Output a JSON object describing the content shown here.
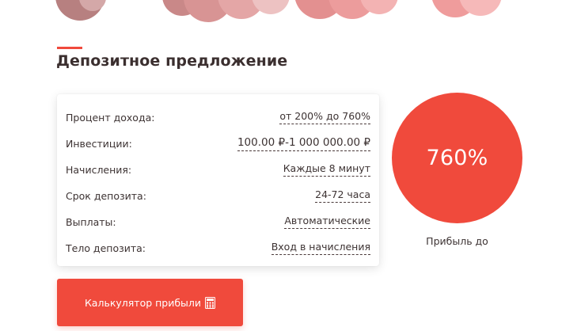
{
  "theme": {
    "accent": "#f04a3c",
    "text": "#3d3333"
  },
  "page": {
    "title": "Депозитное предложение"
  },
  "offer": {
    "rows": [
      {
        "label": "Процент дохода:",
        "value": "от 200% до 760%"
      },
      {
        "label": "Инвестиции:",
        "value": "100.00 ₽-1 000 000.00 ₽"
      },
      {
        "label": "Начисления:",
        "value": "Каждые 8 минут"
      },
      {
        "label": "Срок депозита:",
        "value": "24-72 часа"
      },
      {
        "label": "Выплаты:",
        "value": "Автоматические"
      },
      {
        "label": "Тело депозита:",
        "value": "Вход в начисления"
      }
    ]
  },
  "profit": {
    "percent": "760%",
    "caption": "Прибыль до"
  },
  "calculator": {
    "label": "Калькулятор прибыли",
    "icon": "calculator-icon"
  }
}
